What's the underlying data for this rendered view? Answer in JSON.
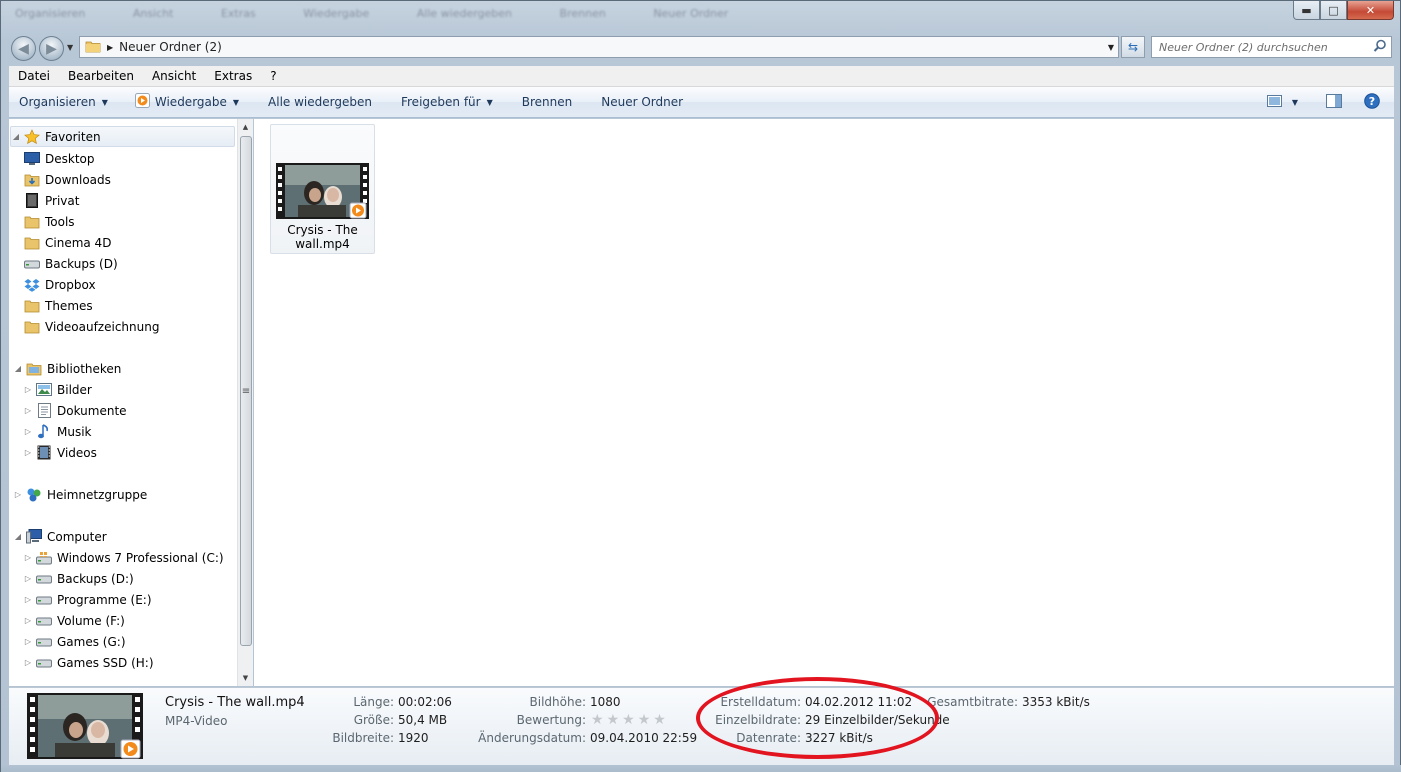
{
  "window": {
    "ghost_menu": [
      "Organisieren",
      "Ansicht",
      "Extras",
      "Wiedergabe",
      "Alle wiedergeben",
      "Brennen",
      "Neuer Ordner"
    ],
    "caption": {
      "minimize": "▬",
      "maximize": "□",
      "close": "✕"
    }
  },
  "address": {
    "path": [
      "Neuer Ordner (2)"
    ],
    "search_placeholder": "Neuer Ordner (2) durchsuchen"
  },
  "menubar": [
    "Datei",
    "Bearbeiten",
    "Ansicht",
    "Extras",
    "?"
  ],
  "toolbar": {
    "organize": "Organisieren",
    "play": "Wiedergabe",
    "play_all": "Alle wiedergeben",
    "share": "Freigeben für",
    "burn": "Brennen",
    "new_folder": "Neuer Ordner"
  },
  "navpane": {
    "favorites": {
      "label": "Favoriten",
      "items": [
        {
          "label": "Desktop",
          "icon": "desktop-icon"
        },
        {
          "label": "Downloads",
          "icon": "downloads-folder-icon"
        },
        {
          "label": "Privat",
          "icon": "private-folder-icon"
        },
        {
          "label": "Tools",
          "icon": "folder-icon"
        },
        {
          "label": "Cinema 4D",
          "icon": "folder-icon"
        },
        {
          "label": "Backups (D)",
          "icon": "drive-icon"
        },
        {
          "label": "Dropbox",
          "icon": "dropbox-icon"
        },
        {
          "label": "Themes",
          "icon": "folder-icon"
        },
        {
          "label": "Videoaufzeichnung",
          "icon": "folder-icon"
        }
      ]
    },
    "libraries": {
      "label": "Bibliotheken",
      "items": [
        {
          "label": "Bilder",
          "icon": "pictures-icon"
        },
        {
          "label": "Dokumente",
          "icon": "documents-icon"
        },
        {
          "label": "Musik",
          "icon": "music-icon"
        },
        {
          "label": "Videos",
          "icon": "videos-icon"
        }
      ]
    },
    "homegroup": {
      "label": "Heimnetzgruppe"
    },
    "computer": {
      "label": "Computer",
      "items": [
        {
          "label": "Windows 7 Professional (C:)",
          "icon": "system-drive-icon"
        },
        {
          "label": "Backups (D:)",
          "icon": "drive-icon"
        },
        {
          "label": "Programme (E:)",
          "icon": "drive-icon"
        },
        {
          "label": "Volume (F:)",
          "icon": "drive-icon"
        },
        {
          "label": "Games (G:)",
          "icon": "drive-icon"
        },
        {
          "label": "Games SSD (H:)",
          "icon": "drive-icon"
        }
      ]
    }
  },
  "files": [
    {
      "name_line1": "Crysis - The",
      "name_line2": "wall.mp4"
    }
  ],
  "details": {
    "name": "Crysis - The wall.mp4",
    "type": "MP4-Video",
    "length_label": "Länge:",
    "length": "00:02:06",
    "size_label": "Größe:",
    "size": "50,4 MB",
    "width_label": "Bildbreite:",
    "width": "1920",
    "height_label": "Bildhöhe:",
    "height": "1080",
    "rating_label": "Bewertung:",
    "rating": 0,
    "rating_max": 5,
    "modified_label": "Änderungsdatum:",
    "modified": "09.04.2010 22:59",
    "created_label": "Erstelldatum:",
    "created": "04.02.2012 11:02",
    "framerate_label": "Einzelbildrate:",
    "framerate": "29 Einzelbilder/Sekunde",
    "datarate_label": "Datenrate:",
    "datarate": "3227 kBit/s",
    "totalbitrate_label": "Gesamtbitrate:",
    "totalbitrate": "3353 kBit/s"
  },
  "colors": {
    "annotation": "#e2141f",
    "toolbar_text": "#1e395b"
  }
}
